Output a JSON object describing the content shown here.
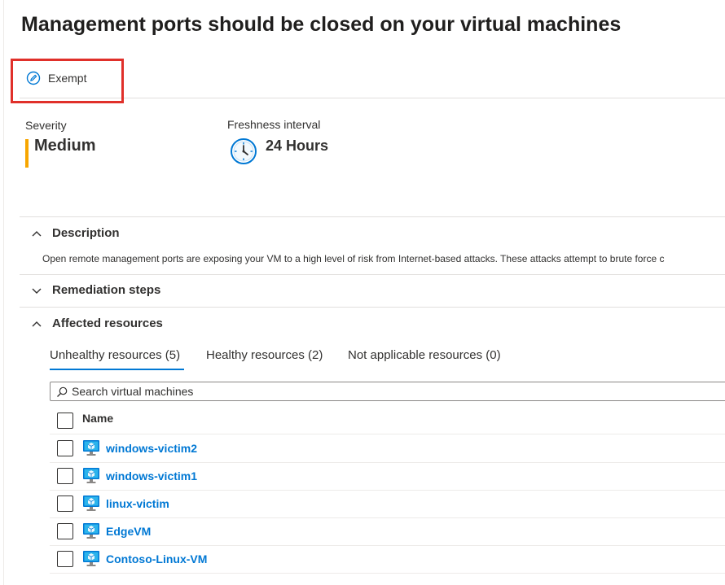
{
  "page": {
    "title": "Management ports should be closed on your virtual machines"
  },
  "toolbar": {
    "exempt_label": "Exempt"
  },
  "summary": {
    "severity_label": "Severity",
    "severity_value": "Medium",
    "severity_color": "#f7a600",
    "freshness_label": "Freshness interval",
    "freshness_value": "24 Hours"
  },
  "sections": {
    "description": {
      "title": "Description",
      "expanded": true,
      "text": "Open remote management ports are exposing your VM to a high level of risk from Internet-based attacks. These attacks attempt to brute force c"
    },
    "remediation": {
      "title": "Remediation steps",
      "expanded": false
    },
    "affected": {
      "title": "Affected resources",
      "expanded": true
    }
  },
  "tabs": [
    {
      "label": "Unhealthy resources (5)",
      "selected": true
    },
    {
      "label": "Healthy resources (2)",
      "selected": false
    },
    {
      "label": "Not applicable resources (0)",
      "selected": false
    }
  ],
  "search": {
    "placeholder": "Search virtual machines"
  },
  "table": {
    "column_name": "Name",
    "rows": [
      {
        "name": "windows-victim2"
      },
      {
        "name": "windows-victim1"
      },
      {
        "name": "linux-victim"
      },
      {
        "name": "EdgeVM"
      },
      {
        "name": "Contoso-Linux-VM"
      }
    ]
  },
  "colors": {
    "accent": "#0078d4",
    "highlight": "#e0302a"
  }
}
